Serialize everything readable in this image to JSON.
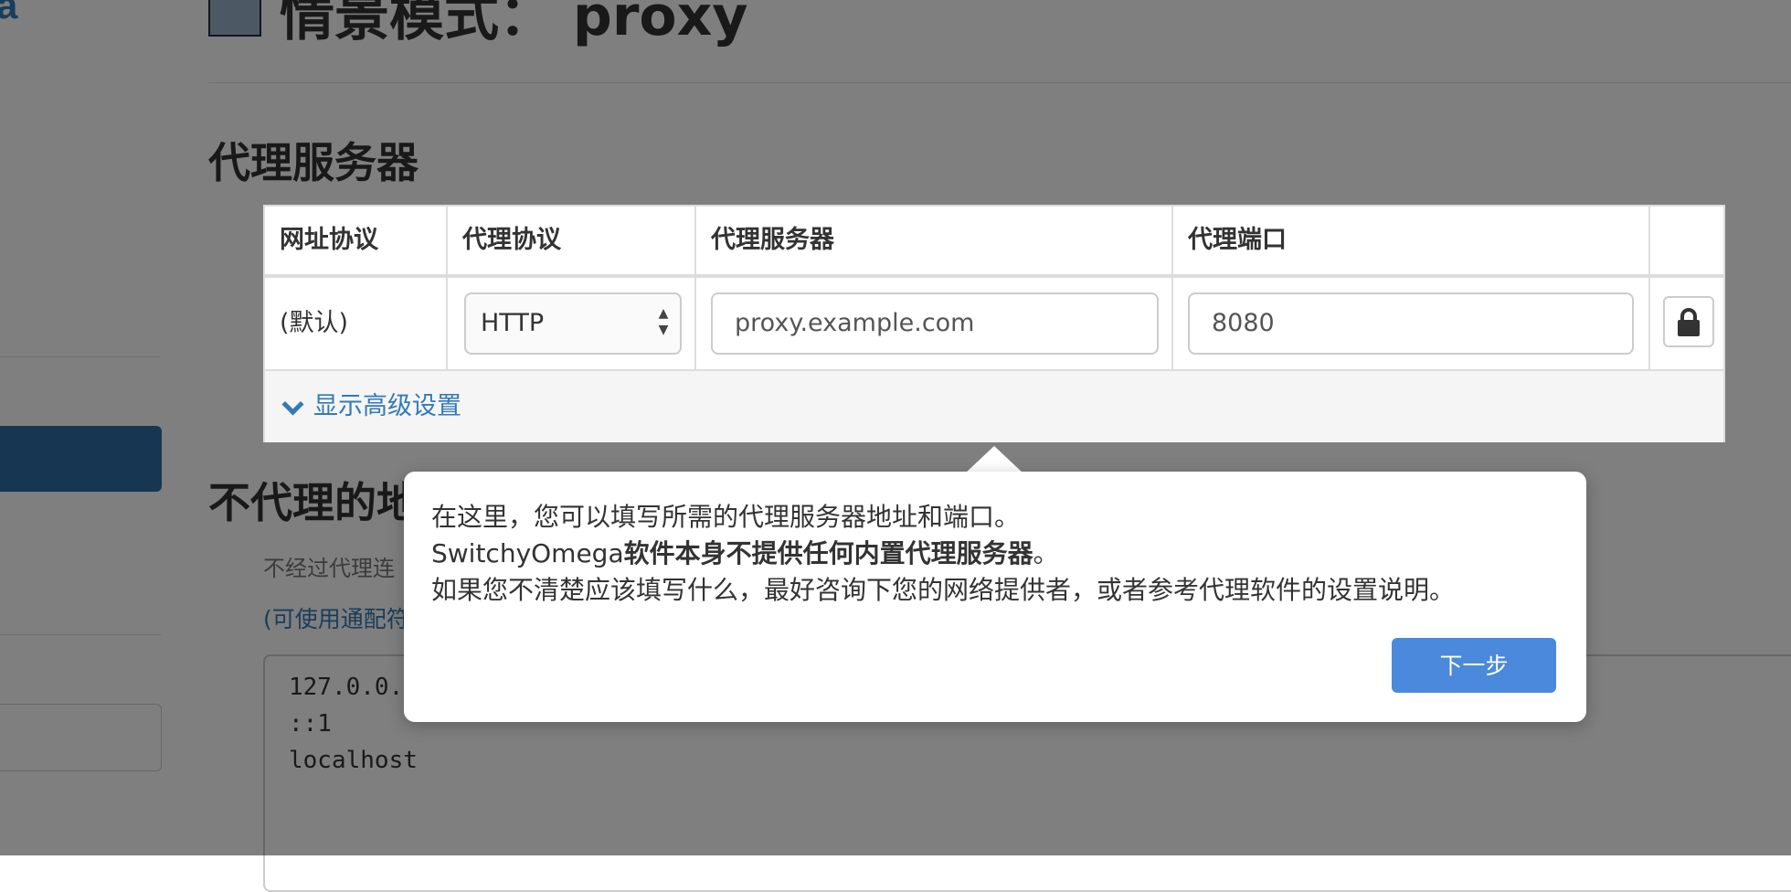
{
  "sidebar": {
    "logo_text": "a"
  },
  "header": {
    "title": "情景模式： proxy"
  },
  "proxy_section": {
    "title": "代理服务器",
    "columns": [
      "网址协议",
      "代理协议",
      "代理服务器",
      "代理端口"
    ],
    "row": {
      "scheme": "(默认)",
      "protocol": "HTTP",
      "server": "proxy.example.com",
      "port": "8080"
    },
    "advanced_link": "显示高级设置"
  },
  "bypass_section": {
    "title": "不代理的地",
    "help": "不经过代理连",
    "wildcard_link": "(可使用通配符",
    "entries": [
      "127.0.0.",
      "::1",
      "localhost"
    ]
  },
  "tour": {
    "line1": "在这里，您可以填写所需的代理服务器地址和端口。",
    "line2_brand": "SwitchyOmega",
    "line2_bold": "软件本身不提供任何内置代理服务器",
    "line2_end": "。",
    "line3": "如果您不清楚应该填写什么，最好咨询下您的网络提供者，或者参考代理软件的设置说明。",
    "next_label": "下一步"
  },
  "colors": {
    "accent": "#337ab7",
    "overlay": "rgba(0,0,0,0.5)",
    "next_button": "#4a89dc"
  }
}
